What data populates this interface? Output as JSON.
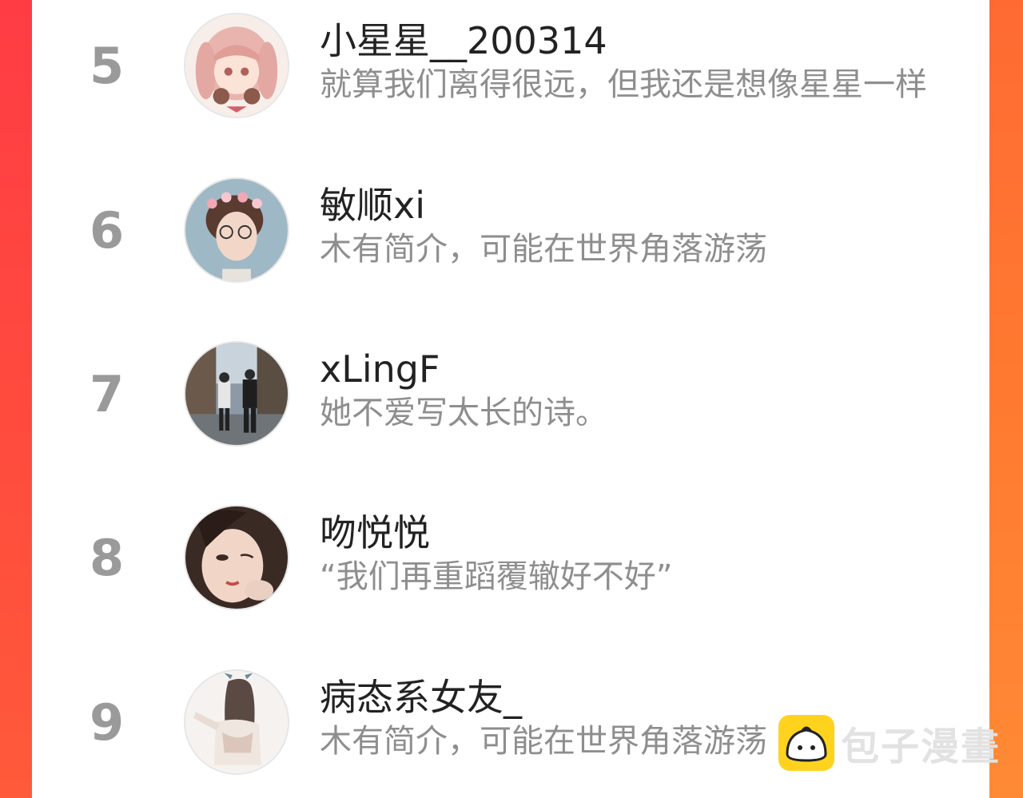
{
  "users": [
    {
      "rank": "5",
      "name": "小星星__200314",
      "bio": "就算我们离得很远，但我还是想像星星一样",
      "avatar": "anime-girl-avatar"
    },
    {
      "rank": "6",
      "name": "敏顺xi",
      "bio": "木有简介，可能在世界角落游荡",
      "avatar": "boy-flower-crown-avatar"
    },
    {
      "rank": "7",
      "name": "xLingF",
      "bio": "她不爱写太长的诗。",
      "avatar": "couple-street-avatar"
    },
    {
      "rank": "8",
      "name": "吻悦悦",
      "bio": "“我们再重蹈覆辙好不好”",
      "avatar": "girl-portrait-avatar"
    },
    {
      "rank": "9",
      "name": "病态系女友_",
      "bio": "木有简介，可能在世界角落游荡",
      "avatar": "anime-girl-back-avatar"
    }
  ],
  "watermark": {
    "text": "包子漫畫",
    "logo": "bun-logo-icon"
  },
  "colors": {
    "accent_left": "#ff4a3d",
    "accent_right": "#ff7a30",
    "rank": "#9a9a9a",
    "name": "#222222",
    "bio": "#8e8e8e",
    "logo": "#ffd21e"
  }
}
